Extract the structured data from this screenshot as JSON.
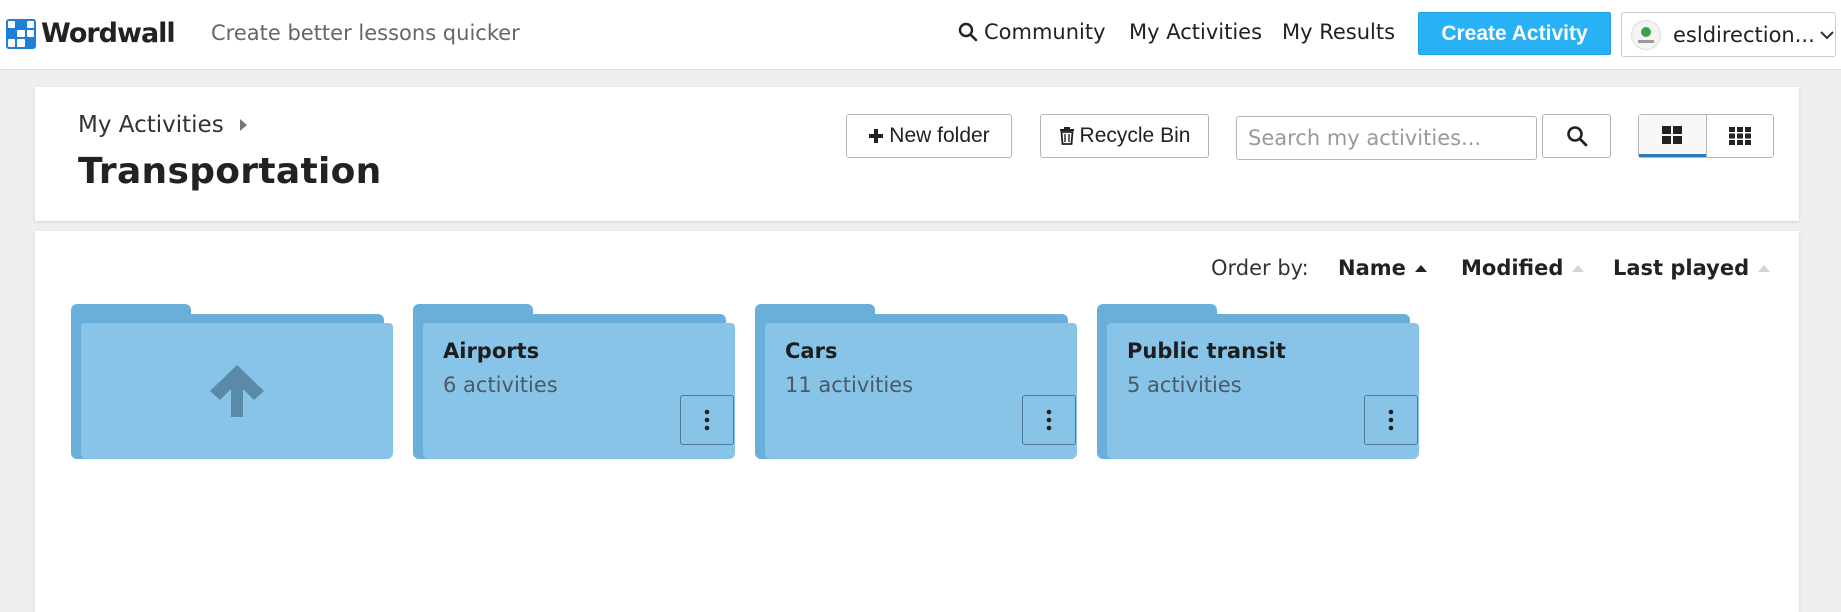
{
  "brand": {
    "name": "Wordwall",
    "tagline": "Create better lessons quicker"
  },
  "nav": {
    "community": "Community",
    "my_activities": "My Activities",
    "my_results": "My Results",
    "create_activity": "Create Activity",
    "account_name": "esldirection..."
  },
  "header": {
    "breadcrumb": "My Activities",
    "title": "Transportation",
    "new_folder": "New folder",
    "recycle_bin": "Recycle Bin",
    "search_placeholder": "Search my activities..."
  },
  "order": {
    "label": "Order by:",
    "name": "Name",
    "modified": "Modified",
    "last_played": "Last played",
    "active": "name"
  },
  "folders": [
    {
      "name": "Airports",
      "count": "6 activities"
    },
    {
      "name": "Cars",
      "count": "11 activities"
    },
    {
      "name": "Public transit",
      "count": "5 activities"
    }
  ],
  "colors": {
    "accent": "#29b1f6",
    "folder_front": "#88c3e8",
    "folder_back": "#6aafd9",
    "up_arrow": "#5b8aa8"
  },
  "icons": [
    "search-icon",
    "chevron-down-icon",
    "plus-icon",
    "trash-icon",
    "grid-large-icon",
    "grid-small-icon",
    "arrow-up-icon",
    "vertical-dots-icon"
  ]
}
